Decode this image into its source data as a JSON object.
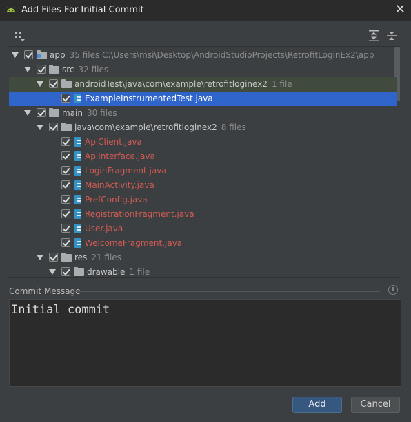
{
  "window": {
    "title": "Add Files For Initial Commit",
    "close_glyph": "✕"
  },
  "colors": {
    "accent": "#365880",
    "selection": "#2f65ca",
    "unversioned_file": "#d35b54"
  },
  "tree": {
    "rows": [
      {
        "label": "app",
        "hint": "35 files  C:\\Users\\msi\\Desktop\\AndroidStudioProjects\\RetrofitLoginEx2\\app",
        "icon": "module-folder-icon"
      },
      {
        "label": "src",
        "hint": "32 files",
        "icon": "folder-icon"
      },
      {
        "label": "androidTest\\java\\com\\example\\retrofitloginex2",
        "hint": "1 file",
        "icon": "folder-icon"
      },
      {
        "label": "ExampleInstrumentedTest.java",
        "hint": "",
        "icon": "java-file-icon"
      },
      {
        "label": "main",
        "hint": "30 files",
        "icon": "folder-icon"
      },
      {
        "label": "java\\com\\example\\retrofitloginex2",
        "hint": "8 files",
        "icon": "folder-icon"
      },
      {
        "label": "ApiClient.java",
        "hint": "",
        "icon": "java-file-icon"
      },
      {
        "label": "ApiInterface.java",
        "hint": "",
        "icon": "java-file-icon"
      },
      {
        "label": "LoginFragment.java",
        "hint": "",
        "icon": "java-file-icon"
      },
      {
        "label": "MainActivity.java",
        "hint": "",
        "icon": "java-file-icon"
      },
      {
        "label": "PrefConfig.java",
        "hint": "",
        "icon": "java-file-icon"
      },
      {
        "label": "RegistrationFragment.java",
        "hint": "",
        "icon": "java-file-icon"
      },
      {
        "label": "User.java",
        "hint": "",
        "icon": "java-file-icon"
      },
      {
        "label": "WelcomeFragment.java",
        "hint": "",
        "icon": "java-file-icon"
      },
      {
        "label": "res",
        "hint": "21 files",
        "icon": "folder-icon"
      },
      {
        "label": "drawable",
        "hint": "1 file",
        "icon": "folder-icon"
      }
    ]
  },
  "commit": {
    "label": "Commit Message",
    "value": "Initial commit"
  },
  "buttons": {
    "add": "Add",
    "cancel": "Cancel"
  }
}
